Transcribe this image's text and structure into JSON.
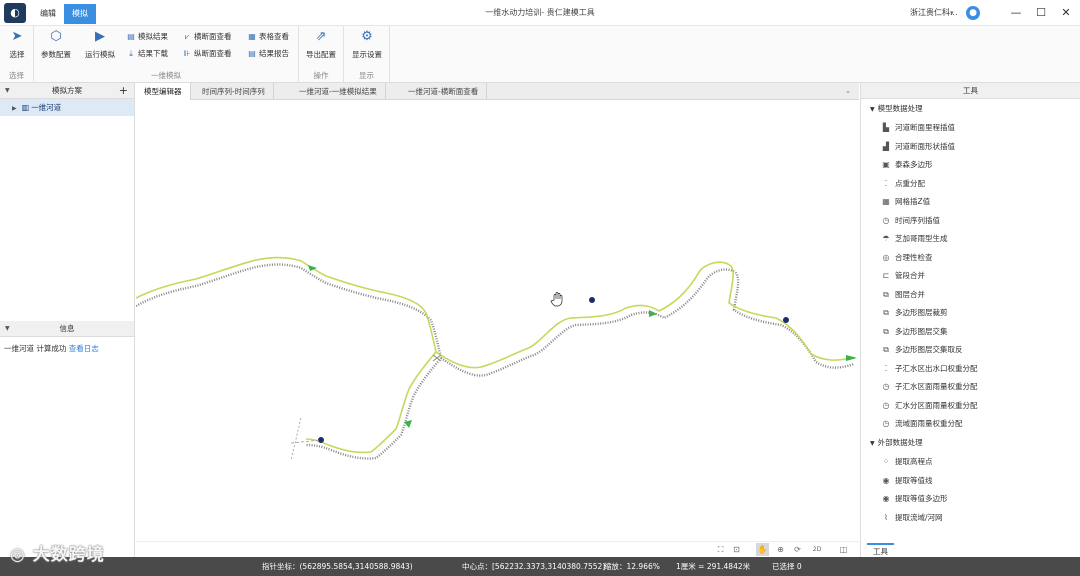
{
  "window": {
    "title": "一维水动力培训- 贵仁建模工具",
    "user": "浙江贵仁科...",
    "user_dropdown": "▾",
    "minimize": "—",
    "maximize": "☐",
    "close": "✕"
  },
  "menu": {
    "app_icon": "◐",
    "tabs": [
      "编辑",
      "模拟"
    ],
    "active_tab": "模拟"
  },
  "ribbon": {
    "select_group": {
      "label": "选择",
      "select_button": "选择"
    },
    "simulate_group": {
      "label": "一维模拟",
      "param_button": "参数配置",
      "run_button": "运行模拟",
      "sim_result": "模拟结果",
      "result_download": "结果下载",
      "cross_section_view": "横断面查看",
      "long_section_view": "纵断面查看",
      "table_view": "表格查看",
      "result_report": "结果报告"
    },
    "operation_group": {
      "label": "操作",
      "export_button": "导出配置"
    },
    "display_group": {
      "label": "显示",
      "display_settings": "显示设置"
    }
  },
  "left_panel": {
    "scheme_title": "模拟方案",
    "add": "+",
    "tree_item": "一维河道",
    "info_title": "信息",
    "info_message": "一维河道 计算成功",
    "info_link": "查看日志"
  },
  "center_tabs": [
    "模型编辑器",
    "时间序列-时间序列",
    "一维河道-一维模拟结果",
    "一维河道-横断面查看"
  ],
  "active_center_tab": "模型编辑器",
  "tab_dropdown": "⌄",
  "right_panel": {
    "title": "工具",
    "section1": "模型数据处理",
    "tools1": [
      {
        "label": "河道断面里程插值",
        "icon": "▙"
      },
      {
        "label": "河道断面形状插值",
        "icon": "▟"
      },
      {
        "label": "泰森多边形",
        "icon": "▣"
      },
      {
        "label": "点重分配",
        "icon": "⁚"
      },
      {
        "label": "网格插Z值",
        "icon": "▦"
      },
      {
        "label": "时间序列插值",
        "icon": "◷"
      },
      {
        "label": "芝加哥雨型生成",
        "icon": "☂"
      },
      {
        "label": "合理性检查",
        "icon": "◎"
      },
      {
        "label": "管段合并",
        "icon": "⊏"
      },
      {
        "label": "图层合并",
        "icon": "⧉"
      },
      {
        "label": "多边形图层裁剪",
        "icon": "⧉"
      },
      {
        "label": "多边形图层交集",
        "icon": "⧉"
      },
      {
        "label": "多边形图层交集取反",
        "icon": "⧉"
      },
      {
        "label": "子汇水区出水口权重分配",
        "icon": "⁚"
      },
      {
        "label": "子汇水区面雨量权重分配",
        "icon": "◷"
      },
      {
        "label": "汇水分区面雨量权重分配",
        "icon": "◷"
      },
      {
        "label": "流域面雨量权重分配",
        "icon": "◷"
      }
    ],
    "section2": "外部数据处理",
    "tools2": [
      {
        "label": "提取高程点",
        "icon": "⁘"
      },
      {
        "label": "提取等值线",
        "icon": "◉"
      },
      {
        "label": "提取等值多边形",
        "icon": "◉"
      },
      {
        "label": "提取流域/河网",
        "icon": "⌇"
      }
    ],
    "bottom_tab": "工具"
  },
  "map_toolbar": [
    "⛶",
    "⊡",
    "✋",
    "⊕",
    "⟳",
    "2D",
    "◫"
  ],
  "status": {
    "pointer": "指针坐标：(562895.5854,3140588.9843)",
    "center": "中心点：[562232.3373,3140380.7552]",
    "zoom": "缩放：12.966%",
    "scale": "1厘米 = 291.4842米",
    "selected": "已选择 0"
  },
  "watermark": "大数跨境",
  "colors": {
    "accent": "#3b8fe0",
    "river": "#c9d65a",
    "node": "#1d2a6b",
    "arrow": "#3cb04a"
  }
}
